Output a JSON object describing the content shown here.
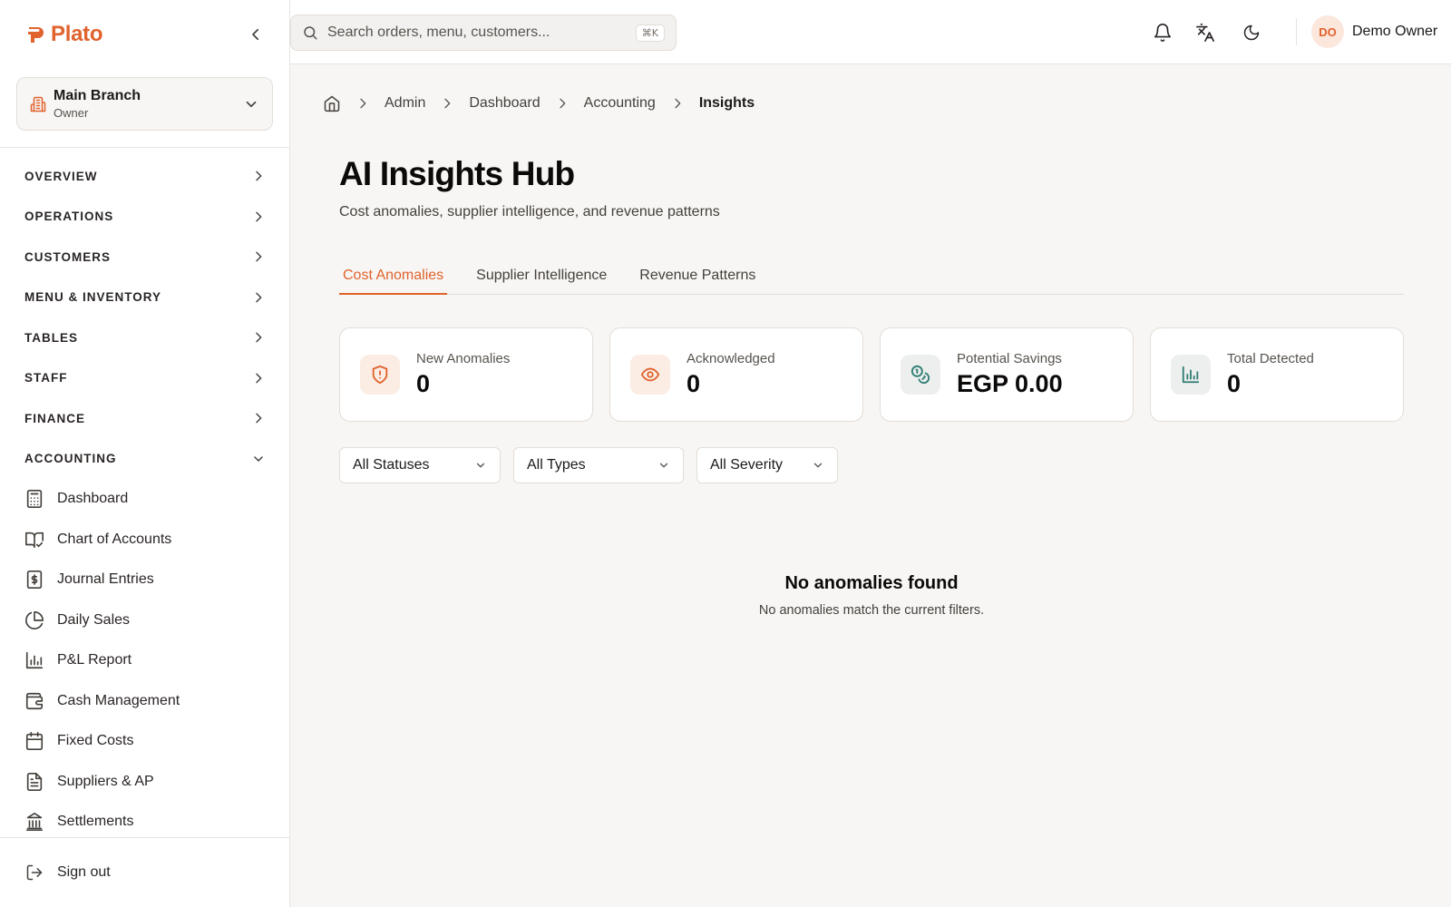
{
  "brand": {
    "name": "Plato",
    "color": "#e0622c"
  },
  "branch": {
    "name": "Main Branch",
    "role": "Owner"
  },
  "sidebar": {
    "sections": [
      {
        "label": "OVERVIEW",
        "expanded": false
      },
      {
        "label": "OPERATIONS",
        "expanded": false
      },
      {
        "label": "CUSTOMERS",
        "expanded": false
      },
      {
        "label": "MENU & INVENTORY",
        "expanded": false
      },
      {
        "label": "TABLES",
        "expanded": false
      },
      {
        "label": "STAFF",
        "expanded": false
      },
      {
        "label": "FINANCE",
        "expanded": false
      },
      {
        "label": "ACCOUNTING",
        "expanded": true
      }
    ],
    "accounting_items": [
      {
        "label": "Dashboard",
        "icon": "calculator-icon"
      },
      {
        "label": "Chart of Accounts",
        "icon": "book-check-icon"
      },
      {
        "label": "Journal Entries",
        "icon": "receipt-dollar-icon"
      },
      {
        "label": "Daily Sales",
        "icon": "pie-chart-icon"
      },
      {
        "label": "P&L Report",
        "icon": "bar-chart-icon"
      },
      {
        "label": "Cash Management",
        "icon": "wallet-icon"
      },
      {
        "label": "Fixed Costs",
        "icon": "calendar-icon"
      },
      {
        "label": "Suppliers & AP",
        "icon": "file-text-icon"
      },
      {
        "label": "Settlements",
        "icon": "bank-icon"
      }
    ],
    "signout_label": "Sign out"
  },
  "topbar": {
    "search_placeholder": "Search orders, menu, customers...",
    "search_shortcut": "⌘K",
    "user": {
      "initials": "DO",
      "name": "Demo Owner"
    }
  },
  "breadcrumb": [
    "Admin",
    "Dashboard",
    "Accounting",
    "Insights"
  ],
  "page": {
    "title": "AI Insights Hub",
    "subtitle": "Cost anomalies, supplier intelligence, and revenue patterns"
  },
  "tabs": [
    {
      "label": "Cost Anomalies",
      "active": true
    },
    {
      "label": "Supplier Intelligence",
      "active": false
    },
    {
      "label": "Revenue Patterns",
      "active": false
    }
  ],
  "stats": [
    {
      "label": "New Anomalies",
      "value": "0",
      "icon": "shield-alert-icon",
      "color": "#e0622c",
      "bg": "#fbece4"
    },
    {
      "label": "Acknowledged",
      "value": "0",
      "icon": "eye-icon",
      "color": "#e0622c",
      "bg": "#fbece4"
    },
    {
      "label": "Potential Savings",
      "value": "EGP 0.00",
      "icon": "coins-icon",
      "color": "#2f7d74",
      "bg": "#ecefed"
    },
    {
      "label": "Total Detected",
      "value": "0",
      "icon": "bar-chart-icon",
      "color": "#2f7d74",
      "bg": "#ecefed"
    }
  ],
  "filters": [
    {
      "label": "All Statuses"
    },
    {
      "label": "All Types"
    },
    {
      "label": "All Severity"
    }
  ],
  "empty_state": {
    "title": "No anomalies found",
    "message": "No anomalies match the current filters."
  }
}
